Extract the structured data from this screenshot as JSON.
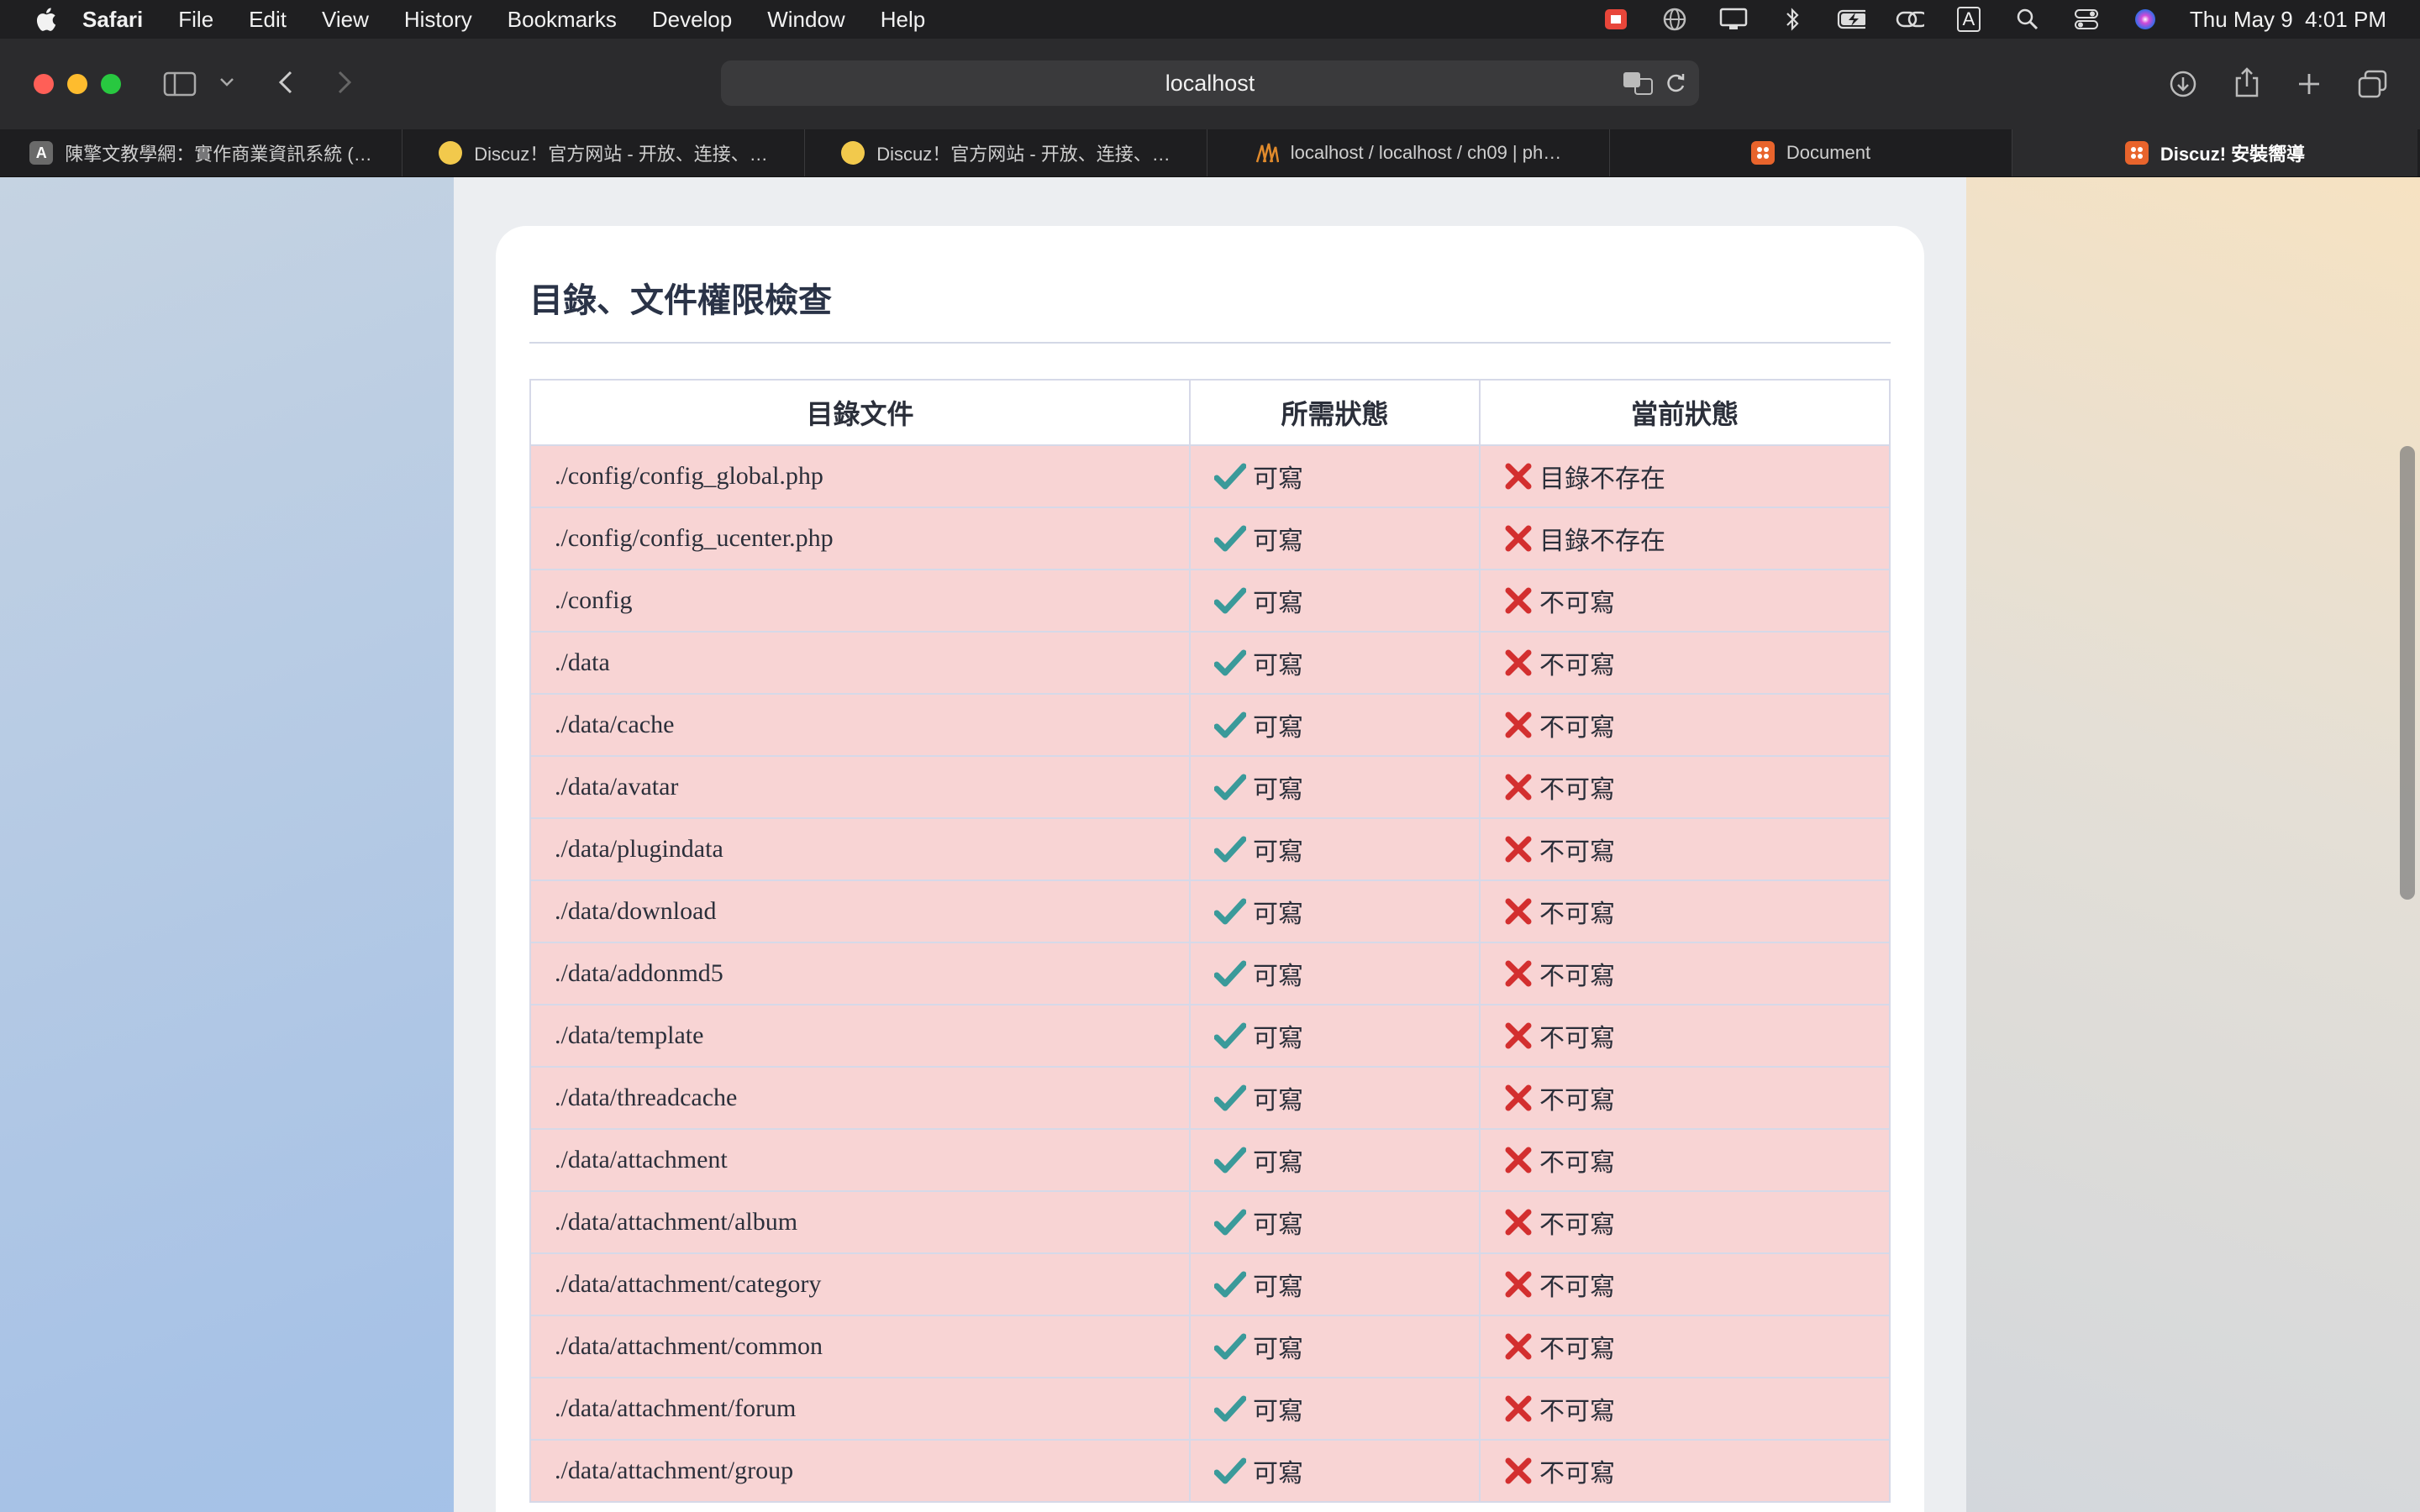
{
  "menubar": {
    "app": "Safari",
    "items": [
      "File",
      "Edit",
      "View",
      "History",
      "Bookmarks",
      "Develop",
      "Window",
      "Help"
    ],
    "clock": "Thu May 9  4:01 PM",
    "input_indicator": "A"
  },
  "toolbar": {
    "url": "localhost"
  },
  "tabs": [
    {
      "label": "陳擎文教學網：實作商業資訊系統 (…",
      "favicon": "A",
      "favicon_color": "#6a6a6a"
    },
    {
      "label": "Discuz！官方网站 - 开放、连接、…",
      "favicon": "",
      "favicon_color": "#f2c94c"
    },
    {
      "label": "Discuz！官方网站 - 开放、连接、…",
      "favicon": "",
      "favicon_color": "#f2c94c"
    },
    {
      "label": "localhost / localhost / ch09 | ph…",
      "favicon": "",
      "favicon_color": "#e08a2c"
    },
    {
      "label": "Document",
      "favicon": "",
      "favicon_color": "#e8642c"
    },
    {
      "label": "Discuz! 安裝嚮導",
      "favicon": "",
      "favicon_color": "#e8642c"
    }
  ],
  "page": {
    "section_title": "目錄、文件權限檢查",
    "table": {
      "headers": [
        "目錄文件",
        "所需狀態",
        "當前狀態"
      ],
      "rows": [
        {
          "path": "./config/config_global.php",
          "required": "可寫",
          "current": "目錄不存在"
        },
        {
          "path": "./config/config_ucenter.php",
          "required": "可寫",
          "current": "目錄不存在"
        },
        {
          "path": "./config",
          "required": "可寫",
          "current": "不可寫"
        },
        {
          "path": "./data",
          "required": "可寫",
          "current": "不可寫"
        },
        {
          "path": "./data/cache",
          "required": "可寫",
          "current": "不可寫"
        },
        {
          "path": "./data/avatar",
          "required": "可寫",
          "current": "不可寫"
        },
        {
          "path": "./data/plugindata",
          "required": "可寫",
          "current": "不可寫"
        },
        {
          "path": "./data/download",
          "required": "可寫",
          "current": "不可寫"
        },
        {
          "path": "./data/addonmd5",
          "required": "可寫",
          "current": "不可寫"
        },
        {
          "path": "./data/template",
          "required": "可寫",
          "current": "不可寫"
        },
        {
          "path": "./data/threadcache",
          "required": "可寫",
          "current": "不可寫"
        },
        {
          "path": "./data/attachment",
          "required": "可寫",
          "current": "不可寫"
        },
        {
          "path": "./data/attachment/album",
          "required": "可寫",
          "current": "不可寫"
        },
        {
          "path": "./data/attachment/category",
          "required": "可寫",
          "current": "不可寫"
        },
        {
          "path": "./data/attachment/common",
          "required": "可寫",
          "current": "不可寫"
        },
        {
          "path": "./data/attachment/forum",
          "required": "可寫",
          "current": "不可寫"
        },
        {
          "path": "./data/attachment/group",
          "required": "可寫",
          "current": "不可寫"
        }
      ]
    }
  },
  "colors": {
    "row_error_bg": "#f8d4d4",
    "check": "#3a9a9a",
    "cross": "#d32f2f"
  }
}
